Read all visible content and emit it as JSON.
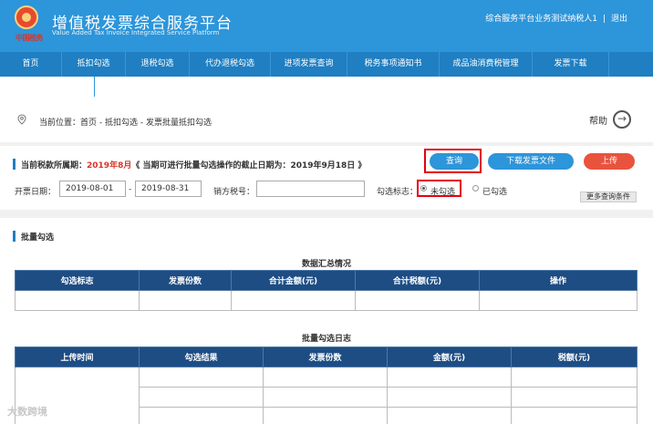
{
  "header": {
    "logo_text": "中国税务",
    "title": "增值税发票综合服务平台",
    "subtitle": "Value Added Tax Invoice Integrated Service Platform",
    "user": "综合服务平台业务测试纳税人1",
    "separator": "|",
    "logout": "退出"
  },
  "nav": {
    "items": [
      "首页",
      "抵扣勾选",
      "退税勾选",
      "代办退税勾选",
      "进项发票查询",
      "税务事项通知书",
      "成品油消费税管理",
      "发票下载"
    ]
  },
  "breadcrumb": {
    "text": "当前位置：首页 - 抵扣勾选 - 发票批量抵扣勾选",
    "help": "帮助"
  },
  "query": {
    "period_label": "当前税款所属期：",
    "period_value": "2019年8月",
    "period_note": "《 当期可进行批量勾选操作的截止日期为：2019年9月18日 》",
    "btn_query": "查询",
    "btn_download": "下载发票文件",
    "btn_upload": "上传",
    "date_label": "开票日期：",
    "date_from": "2019-08-01",
    "date_sep": "-",
    "date_to": "2019-08-31",
    "seller_tax_label": "销方税号：",
    "seller_tax_value": "",
    "flag_label": "勾选标志：",
    "flag_unselected": "未勾选",
    "flag_selected": "已勾选",
    "more": "更多查询条件"
  },
  "batch": {
    "title": "批量勾选",
    "summary_caption": "数据汇总情况",
    "summary_headers": [
      "勾选标志",
      "发票份数",
      "合计金额(元)",
      "合计税额(元)",
      "操作"
    ],
    "log_caption": "批量勾选日志",
    "log_headers": [
      "上传时间",
      "勾选结果",
      "发票份数",
      "金额(元)",
      "税额(元)"
    ]
  },
  "watermark": "大数跨境"
}
